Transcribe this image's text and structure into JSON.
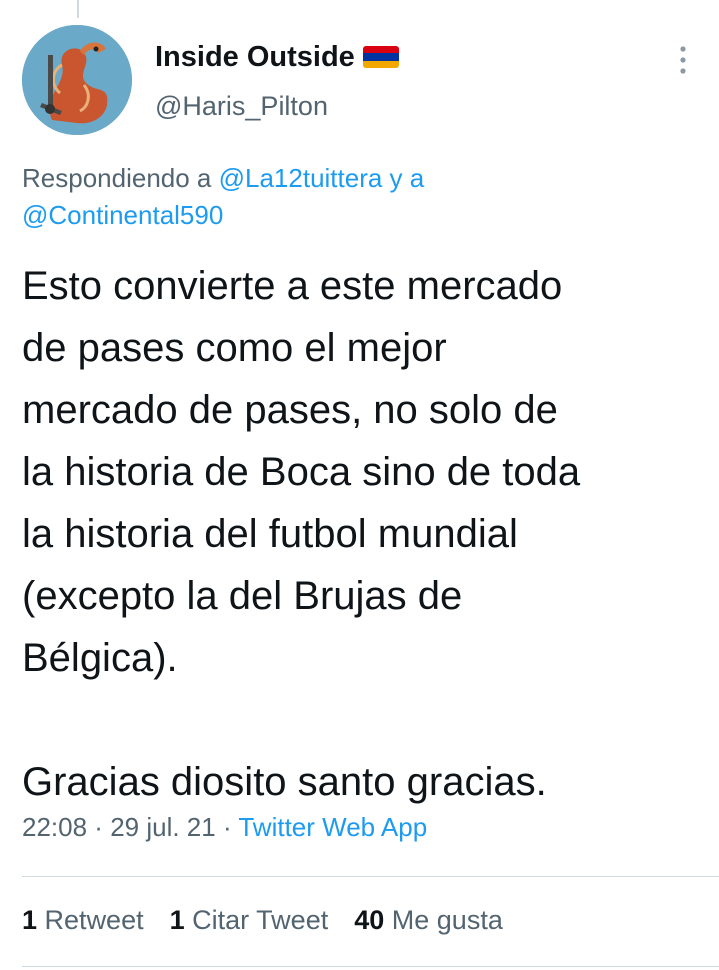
{
  "user": {
    "display_name": "Inside Outside",
    "handle": "@Haris_Pilton",
    "flag_icon": "armenia-flag-icon",
    "flag_colors": [
      "#d90012",
      "#0033a0",
      "#f2a800"
    ]
  },
  "replying": {
    "prefix": "Respondiendo a ",
    "mention1": "@La12tuittera",
    "conj": " y a",
    "mention2": "@Continental590"
  },
  "tweet": {
    "text": "Esto convierte a este mercado\nde pases como el mejor\nmercado de pases, no solo de\nla historia de Boca sino de toda\nla historia del futbol mundial\n(excepto la del Brujas de\nBélgica).\n\nGracias diosito santo gracias."
  },
  "meta": {
    "time": "22:08",
    "sep1": " · ",
    "date": "29 jul. 21",
    "sep2": " · ",
    "app": "Twitter Web App"
  },
  "stats": {
    "retweets_count": "1",
    "retweets_label": "Retweet",
    "quotes_count": "1",
    "quotes_label": "Citar Tweet",
    "likes_count": "40",
    "likes_label": "Me gusta"
  },
  "colors": {
    "accent": "#1d9bf0",
    "secondary_text": "#536471",
    "primary_text": "#0f1419"
  }
}
